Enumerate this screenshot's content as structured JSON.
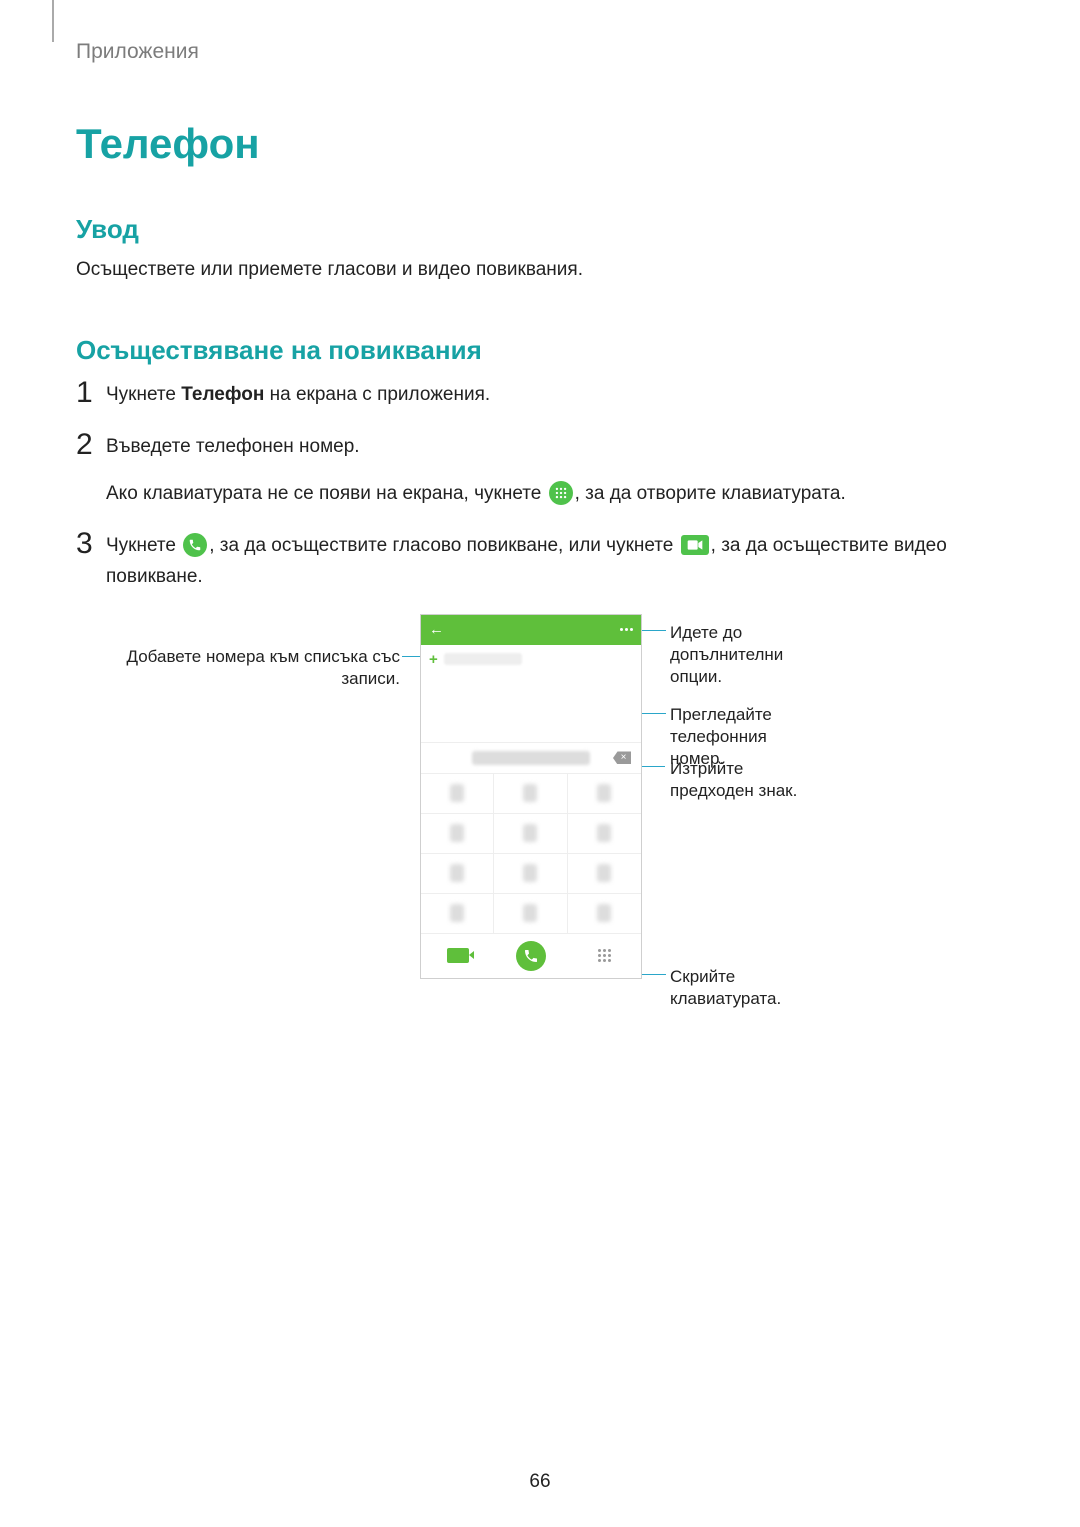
{
  "breadcrumb": "Приложения",
  "title": "Телефон",
  "section_intro_heading": "Увод",
  "section_intro_text": "Осъществете или приемете гласови и видео повиквания.",
  "section_calls_heading": "Осъществяване на повиквания",
  "steps": {
    "s1_pre": "Чукнете ",
    "s1_bold": "Телефон",
    "s1_post": " на екрана с приложения.",
    "s2_a": "Въведете телефонен номер.",
    "s2_b_pre": "Ако клавиатурата не се появи на екрана, чукнете ",
    "s2_b_post": ", за да отворите клавиатурата.",
    "s3_pre": "Чукнете ",
    "s3_mid": ", за да осъществите гласово повикване, или чукнете ",
    "s3_post": ", за да осъществите видео повикване."
  },
  "annotations": {
    "left_add": "Добавете номера към списъка със записи.",
    "right_more": "Идете до допълнителни опции.",
    "right_preview": "Прегледайте телефонния номер.",
    "right_delete": "Изтрийте предходен знак.",
    "right_hidekb": "Скрийте клавиатурата."
  },
  "page_number": "66"
}
